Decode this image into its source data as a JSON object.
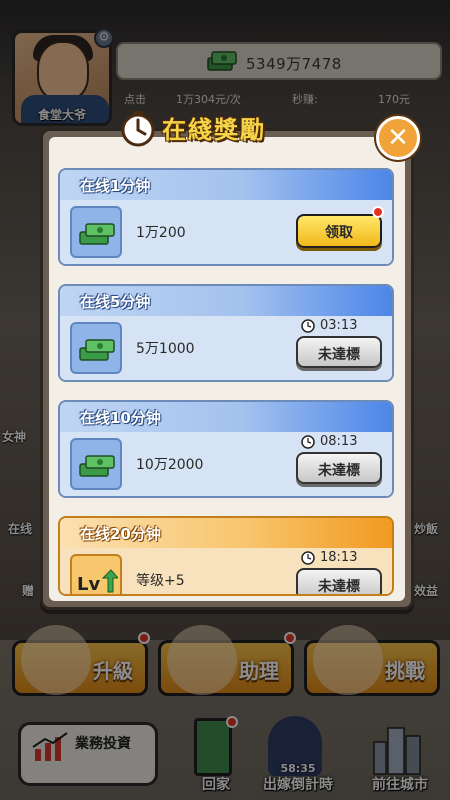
{
  "hud": {
    "player_name": "食堂大爷",
    "money": "5349万7478",
    "rate_label": "点击",
    "rate_value": "1万304元/次",
    "per_sec_label": "秒赚:",
    "per_sec_value": "170元"
  },
  "side_labels": [
    "女神",
    "在线",
    "赠",
    "炒飯",
    "效益"
  ],
  "bottom_buttons": {
    "upgrade": "升級",
    "assistant": "助理",
    "challenge": "挑戰"
  },
  "bottom_nav": {
    "invest": "業務投資",
    "home": "回家",
    "countdown_label": "出嫁倒計時",
    "countdown_timer": "58:35",
    "city": "前往城市"
  },
  "modal": {
    "title": "在綫獎勵",
    "rewards": [
      {
        "header": "在线1分钟",
        "amount": "1万200",
        "action": "领取",
        "timer": ""
      },
      {
        "header": "在线5分钟",
        "amount": "5万1000",
        "action": "未達標",
        "timer": "03:13"
      },
      {
        "header": "在线10分钟",
        "amount": "10万2000",
        "action": "未達標",
        "timer": "08:13"
      },
      {
        "header": "在线20分钟",
        "amount": "等级+5",
        "action": "未達標",
        "timer": "18:13"
      }
    ]
  },
  "colors": {
    "accent_gold": "#f2b81b",
    "card_blue": "#4d86e8",
    "card_orange": "#f19a1f",
    "close_orange": "#f1a33a"
  },
  "icons": [
    "gear-icon",
    "cash-icon",
    "clock-icon",
    "close-icon",
    "timer-icon",
    "level-up-icon",
    "chart-icon",
    "door-icon",
    "city-icon"
  ]
}
